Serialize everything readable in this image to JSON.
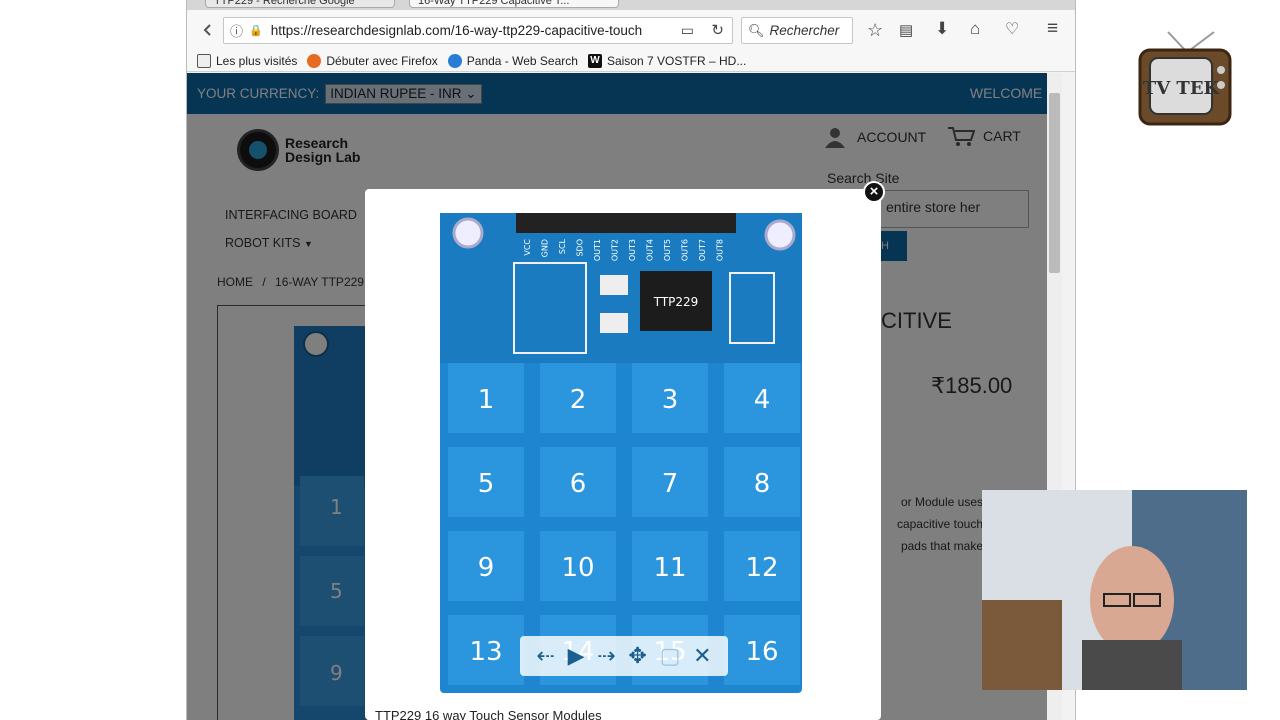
{
  "browser": {
    "tabs": [
      "TTP229 - Recherche Google",
      "16-Way TTP229 Capacitive T..."
    ],
    "url": "https://researchdesignlab.com/16-way-ttp229-capacitive-touch",
    "search_placeholder": "Rechercher",
    "bookmarks": [
      "Les plus visités",
      "Débuter avec Firefox",
      "Panda - Web Search",
      "Saison 7 VOSTFR – HD..."
    ]
  },
  "site": {
    "currency_label": "YOUR CURRENCY:",
    "currency_value": "INDIAN RUPEE - INR",
    "welcome": "WELCOME !",
    "logo_line1": "Research",
    "logo_line2": "Design Lab",
    "account": "ACCOUNT",
    "cart": "CART",
    "search_site_label": "Search Site",
    "search_input_value": "entire store her",
    "search_button": "H",
    "menu": [
      "INTERFACING BOARD",
      "ROBOT KITS"
    ],
    "breadcrumb_home": "HOME",
    "breadcrumb_sep": "/",
    "breadcrumb_current": "16-WAY TTP229",
    "product_title": "CITIVE",
    "price": "₹185.00",
    "description_lines": [
      "or Module uses",
      "capacitive touch",
      "pads that make"
    ]
  },
  "lightbox": {
    "caption": "TTP229 16 way Touch Sensor Modules",
    "pads": [
      "1",
      "2",
      "3",
      "4",
      "5",
      "6",
      "7",
      "8",
      "9",
      "10",
      "11",
      "12",
      "13",
      "14",
      "15",
      "16"
    ],
    "header_pins": [
      "VCC",
      "GND",
      "SCL",
      "SDO",
      "OUT1",
      "OUT2",
      "OUT3",
      "OUT4",
      "OUT5",
      "OUT6",
      "OUT7",
      "OUT8"
    ],
    "chip_label": "TTP229",
    "close_label": "×"
  },
  "overlay_logo": {
    "text": "TV TEK"
  },
  "colors": {
    "site_blue": "#0d6aa8",
    "pcb_blue": "#1e86d0",
    "pad_blue": "#2b95dd"
  }
}
